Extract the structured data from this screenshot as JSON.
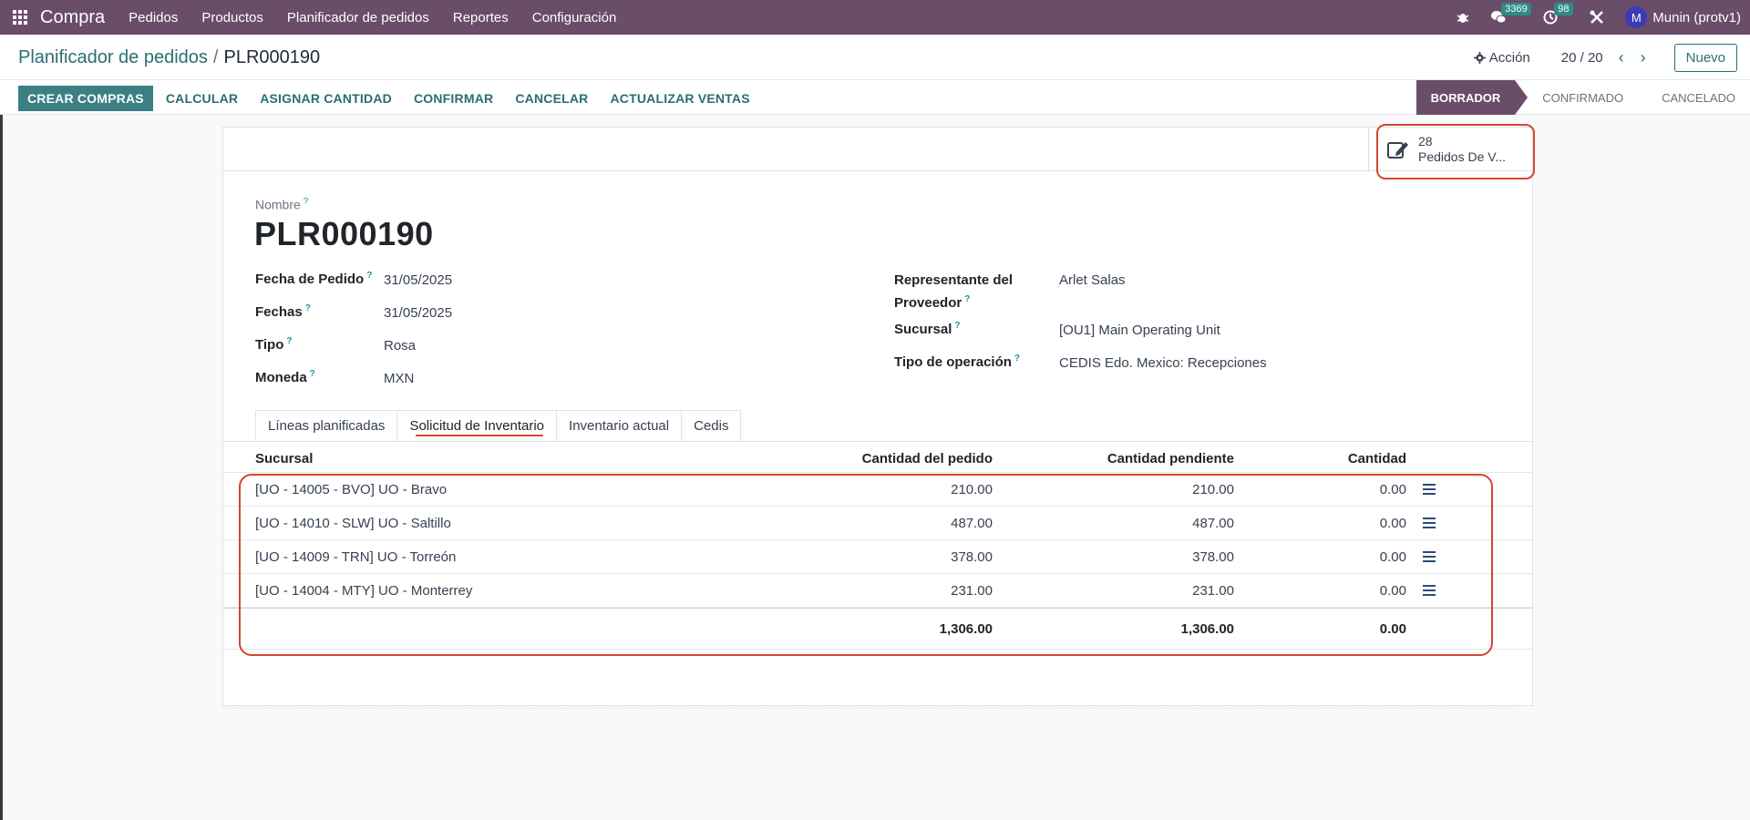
{
  "navbar": {
    "brand": "Compra",
    "menu": [
      "Pedidos",
      "Productos",
      "Planificador de pedidos",
      "Reportes",
      "Configuración"
    ],
    "messages_count": "3369",
    "activities_count": "98",
    "user_initial": "M",
    "user_name": "Munin (protv1)"
  },
  "breadcrumb": {
    "parent": "Planificador de pedidos",
    "separator": "/",
    "current": "PLR000190"
  },
  "control": {
    "action_label": "Acción",
    "pager": "20 / 20",
    "new_label": "Nuevo"
  },
  "actions": [
    "CREAR COMPRAS",
    "CALCULAR",
    "ASIGNAR CANTIDAD",
    "CONFIRMAR",
    "CANCELAR",
    "ACTUALIZAR VENTAS"
  ],
  "statuses": [
    "BORRADOR",
    "CONFIRMADO",
    "CANCELADO"
  ],
  "smart_button": {
    "count": "28",
    "label": "Pedidos De V..."
  },
  "form": {
    "name_label": "Nombre",
    "name": "PLR000190",
    "left_fields": [
      {
        "label": "Fecha de Pedido",
        "value": "31/05/2025"
      },
      {
        "label": "Fechas",
        "value": "31/05/2025"
      },
      {
        "label": "Tipo",
        "value": "Rosa"
      },
      {
        "label": "Moneda",
        "value": "MXN"
      }
    ],
    "right_fields": [
      {
        "label_line1": "Representante del",
        "label_line2": "Proveedor",
        "value": "Arlet Salas"
      },
      {
        "label": "Sucursal",
        "value": "[OU1] Main Operating Unit"
      },
      {
        "label": "Tipo de operación",
        "value": "CEDIS Edo. Mexico: Recepciones"
      }
    ]
  },
  "tabs": [
    "Líneas planificadas",
    "Solicitud de Inventario",
    "Inventario actual",
    "Cedis"
  ],
  "table": {
    "headers": [
      "Sucursal",
      "Cantidad del pedido",
      "Cantidad pendiente",
      "Cantidad"
    ],
    "rows": [
      [
        "[UO - 14005 - BVO] UO - Bravo",
        "210.00",
        "210.00",
        "0.00"
      ],
      [
        "[UO - 14010 - SLW] UO - Saltillo",
        "487.00",
        "487.00",
        "0.00"
      ],
      [
        "[UO - 14009 - TRN] UO - Torreón",
        "378.00",
        "378.00",
        "0.00"
      ],
      [
        "[UO - 14004 - MTY] UO - Monterrey",
        "231.00",
        "231.00",
        "0.00"
      ]
    ],
    "totals": [
      "1,306.00",
      "1,306.00",
      "0.00"
    ]
  }
}
